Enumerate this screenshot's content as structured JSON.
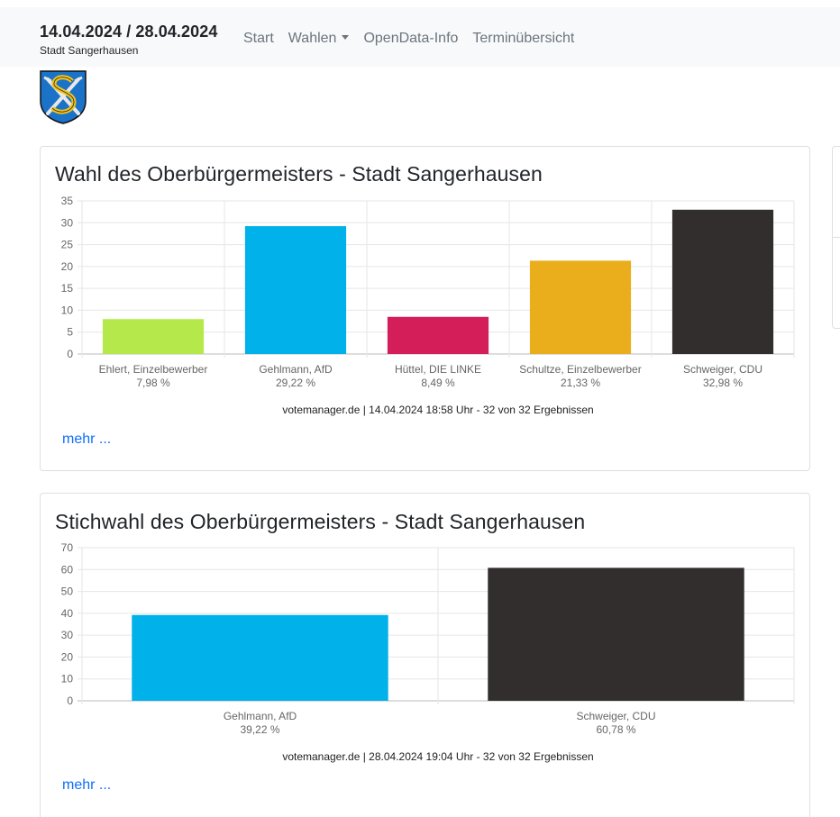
{
  "navbar": {
    "title": "14.04.2024 / 28.04.2024",
    "subtitle": "Stadt Sangerhausen",
    "links": [
      "Start",
      "Wahlen",
      "OpenData-Info",
      "Terminübersicht"
    ]
  },
  "logo": {
    "icon": "coat-of-arms-icon"
  },
  "cards": [
    {
      "title": "Wahl des Oberbürgermeisters - Stadt Sangerhausen",
      "more_label": "mehr ..."
    },
    {
      "title": "Stichwahl des Oberbürgermeisters - Stadt Sangerhausen",
      "more_label": "mehr ..."
    }
  ],
  "chart_data": [
    {
      "type": "bar",
      "categories": [
        "Ehlert, Einzelbewerber",
        "Gehlmann, AfD",
        "Hüttel, DIE LINKE",
        "Schultze, Einzelbewerber",
        "Schweiger, CDU"
      ],
      "values": [
        7.98,
        29.22,
        8.49,
        21.33,
        32.98
      ],
      "value_labels": [
        "7,98 %",
        "29,22 %",
        "8,49 %",
        "21,33 %",
        "32,98 %"
      ],
      "colors": [
        "#b5e94b",
        "#00b1ea",
        "#d31e5a",
        "#eaae1c",
        "#312e2d"
      ],
      "ylim": [
        0,
        35
      ],
      "yticks": [
        0,
        5,
        10,
        15,
        20,
        25,
        30,
        35
      ],
      "grid": true,
      "caption": "votemanager.de | 14.04.2024 18:58 Uhr - 32 von 32 Ergebnissen"
    },
    {
      "type": "bar",
      "categories": [
        "Gehlmann, AfD",
        "Schweiger, CDU"
      ],
      "values": [
        39.22,
        60.78
      ],
      "value_labels": [
        "39,22 %",
        "60,78 %"
      ],
      "colors": [
        "#00b1ea",
        "#312e2d"
      ],
      "ylim": [
        0,
        70
      ],
      "yticks": [
        0,
        10,
        20,
        30,
        40,
        50,
        60,
        70
      ],
      "grid": true,
      "caption": "votemanager.de | 28.04.2024 19:04 Uhr - 32 von 32 Ergebnissen"
    }
  ]
}
